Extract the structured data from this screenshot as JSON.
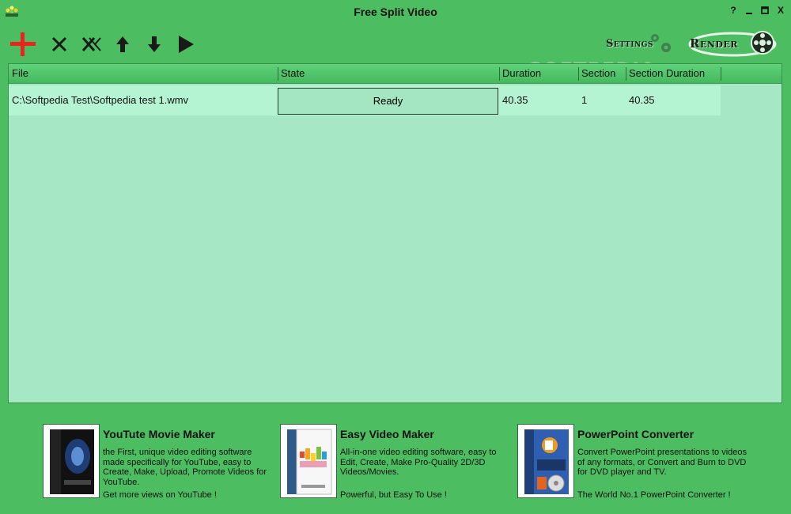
{
  "window": {
    "title": "Free Split Video",
    "help_label": "?",
    "close_label": "X"
  },
  "toolbar": {
    "settings_label": "Settings",
    "render_label": "Render",
    "colors": {
      "add": "#e8241c",
      "icons": "#1a1a1a"
    }
  },
  "watermark": "SOFTPEDIA",
  "grid": {
    "columns": [
      "File",
      "State",
      "Duration",
      "Section",
      "Section Duration"
    ],
    "rows": [
      {
        "file": "C:\\Softpedia Test\\Softpedia test 1.wmv",
        "state": "Ready",
        "duration": "40.35",
        "section": "1",
        "section_duration": "40.35"
      }
    ]
  },
  "ads": [
    {
      "title": "YouTute Movie Maker",
      "desc": "the First, unique video editing software made specifically for YouTube, easy to Create, Make, Upload, Promote Videos for YouTube.",
      "tag": "Get more views on YouTube !"
    },
    {
      "title": "Easy Video Maker",
      "desc": "All-in-one video editing software, easy to Edit, Create, Make Pro-Quality 2D/3D Videos/Movies.",
      "tag": "Powerful, but Easy To Use !"
    },
    {
      "title": "PowerPoint Converter",
      "desc": "Convert PowerPoint presentations to videos of any formats, or Convert and Burn to DVD for DVD player and TV.",
      "tag": "The World No.1 PowerPoint Converter !"
    }
  ]
}
